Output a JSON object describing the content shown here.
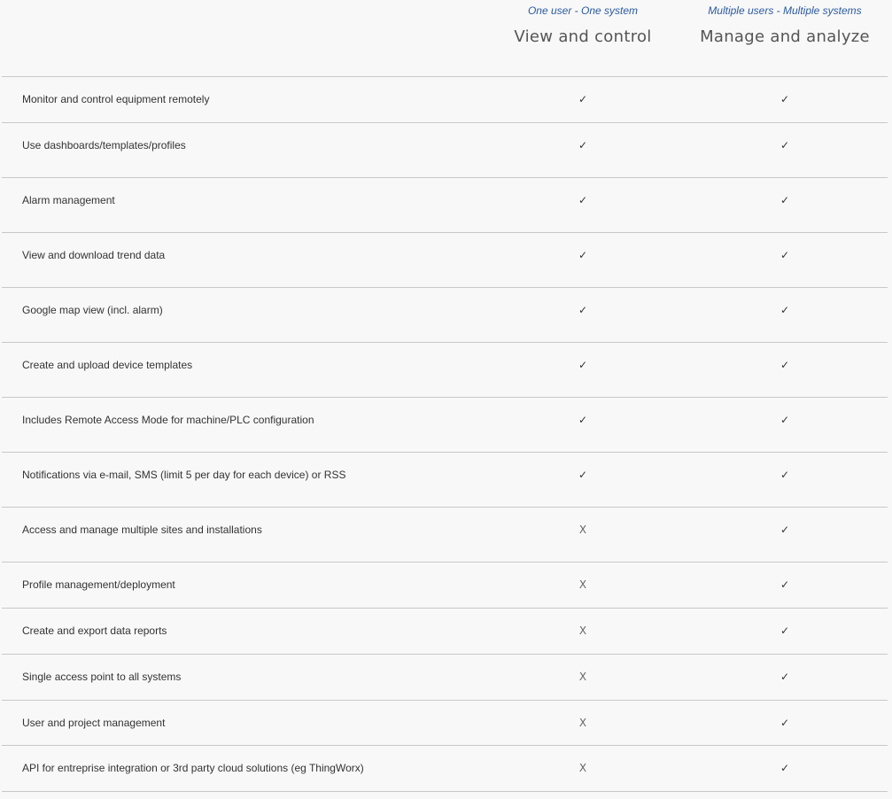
{
  "columns": [
    {
      "tag": "One user - One system",
      "title": "View and control"
    },
    {
      "tag": "Multiple users - Multiple systems",
      "title": "Manage and analyze"
    }
  ],
  "symbols": {
    "check": "✓",
    "cross": "X"
  },
  "rows": [
    {
      "feature": "Monitor and control equipment remotely",
      "a": "✓",
      "b": "✓"
    },
    {
      "feature": "Use dashboards/templates/profiles",
      "a": "✓",
      "b": "✓"
    },
    {
      "feature": "Alarm management",
      "a": "✓",
      "b": "✓"
    },
    {
      "feature": "View and download trend data",
      "a": "✓",
      "b": "✓"
    },
    {
      "feature": "Google map view (incl. alarm)",
      "a": "✓",
      "b": "✓"
    },
    {
      "feature": "Create and upload device templates",
      "a": "✓",
      "b": "✓"
    },
    {
      "feature": "Includes Remote Access Mode for machine/PLC configuration",
      "a": "✓",
      "b": "✓"
    },
    {
      "feature": "Notifications via e-mail, SMS (limit 5 per day for each device) or RSS",
      "a": "✓",
      "b": "✓"
    },
    {
      "feature": "Access and manage multiple sites and installations",
      "a": "X",
      "b": "✓"
    },
    {
      "feature": "Profile management/deployment",
      "a": "X",
      "b": "✓"
    },
    {
      "feature": "Create and export data reports",
      "a": "X",
      "b": "✓"
    },
    {
      "feature": "Single access point to all systems",
      "a": "X",
      "b": "✓"
    },
    {
      "feature": "User and project management",
      "a": "X",
      "b": "✓"
    },
    {
      "feature": "API for entreprise integration or 3rd party cloud solutions (eg ThingWorx)",
      "a": "X",
      "b": "✓"
    }
  ]
}
